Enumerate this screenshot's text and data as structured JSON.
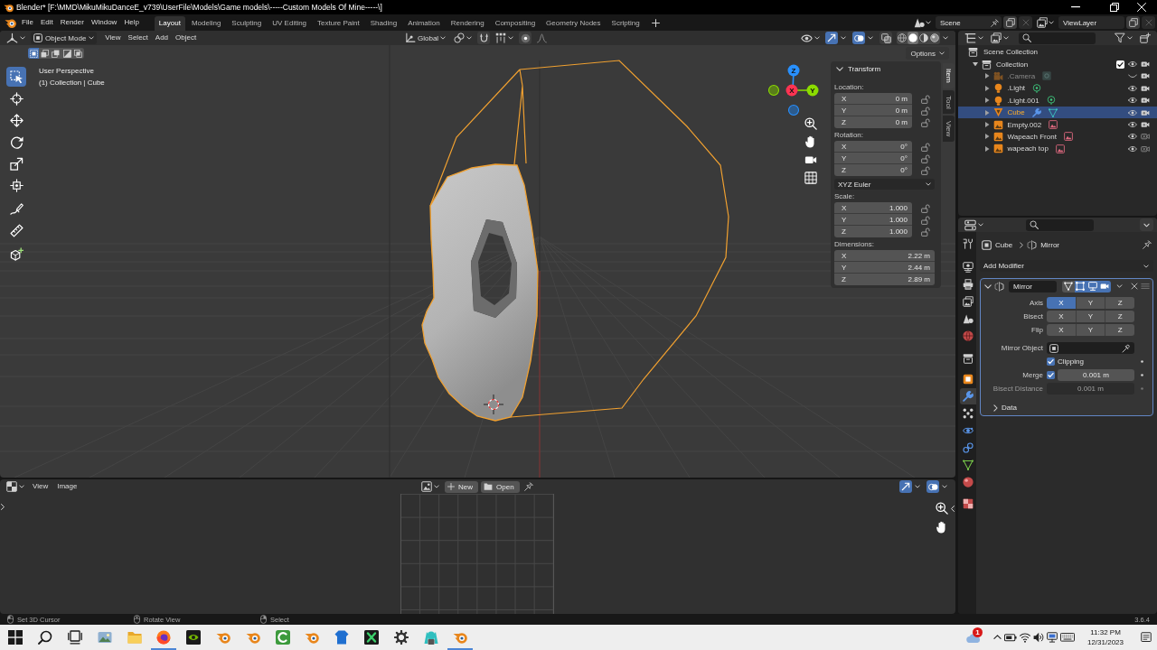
{
  "window": {
    "title": "Blender* [F:\\MMD\\MikuMikuDanceE_v739\\UserFile\\Models\\Game models\\-----Custom Models Of Mine-----\\]"
  },
  "menu": [
    "File",
    "Edit",
    "Render",
    "Window",
    "Help"
  ],
  "workspaces": [
    {
      "label": "Layout",
      "selected": true
    },
    {
      "label": "Modeling",
      "selected": false
    },
    {
      "label": "Sculpting",
      "selected": false
    },
    {
      "label": "UV Editing",
      "selected": false
    },
    {
      "label": "Texture Paint",
      "selected": false
    },
    {
      "label": "Shading",
      "selected": false
    },
    {
      "label": "Animation",
      "selected": false
    },
    {
      "label": "Rendering",
      "selected": false
    },
    {
      "label": "Compositing",
      "selected": false
    },
    {
      "label": "Geometry Nodes",
      "selected": false
    },
    {
      "label": "Scripting",
      "selected": false
    }
  ],
  "scene": "Scene",
  "view_layer": "ViewLayer",
  "viewport": {
    "header": {
      "mode": "Object Mode",
      "menus": [
        "View",
        "Select",
        "Add",
        "Object"
      ],
      "orientation": "Global",
      "snap": false,
      "proportional_edit": false,
      "show_gizmos": true,
      "show_overlays": true,
      "xray": false,
      "shading": [
        {
          "kind": "wireframe",
          "selected": false
        },
        {
          "kind": "solid",
          "selected": true
        },
        {
          "kind": "material",
          "selected": false
        },
        {
          "kind": "rendered",
          "selected": false
        }
      ]
    },
    "select_modes": [
      {
        "kind": "set",
        "selected": true
      },
      {
        "kind": "extend",
        "selected": false
      },
      {
        "kind": "subtract",
        "selected": false
      },
      {
        "kind": "invert",
        "selected": false
      },
      {
        "kind": "intersect",
        "selected": false
      }
    ],
    "options": "Options",
    "tools": [
      {
        "kind": "select",
        "selected": true
      },
      {
        "kind": "cursor",
        "selected": false
      },
      {
        "kind": "move",
        "selected": false
      },
      {
        "kind": "rotate",
        "selected": false
      },
      {
        "kind": "scale",
        "selected": false
      },
      {
        "kind": "transform",
        "selected": false
      },
      {
        "kind": "annotate",
        "selected": false
      },
      {
        "kind": "measure",
        "selected": false
      },
      {
        "kind": "addcube",
        "selected": false
      }
    ],
    "view_name": "User Perspective",
    "context": "(1) Collection | Cube",
    "gizmo_axes": [
      {
        "label": "X",
        "color": "#ff3352"
      },
      {
        "label": "Y",
        "color": "#8bdc00"
      },
      {
        "label": "Z",
        "color": "#2890ff"
      }
    ],
    "transform": {
      "title": "Transform",
      "rotation_mode": "XYZ Euler",
      "groups": [
        {
          "kind": "location",
          "label": "Location:",
          "fields": [
            {
              "axis": "X",
              "value": "0 m",
              "locked": false
            },
            {
              "axis": "Y",
              "value": "0 m",
              "locked": false
            },
            {
              "axis": "Z",
              "value": "0 m",
              "locked": false
            }
          ]
        },
        {
          "kind": "rotation",
          "label": "Rotation:",
          "fields": [
            {
              "axis": "X",
              "value": "0°",
              "locked": false
            },
            {
              "axis": "Y",
              "value": "0°",
              "locked": false
            },
            {
              "axis": "Z",
              "value": "0°",
              "locked": false
            }
          ]
        },
        {
          "kind": "scale",
          "label": "Scale:",
          "fields": [
            {
              "axis": "X",
              "value": "1.000",
              "locked": false
            },
            {
              "axis": "Y",
              "value": "1.000",
              "locked": false
            },
            {
              "axis": "Z",
              "value": "1.000",
              "locked": false
            }
          ]
        },
        {
          "kind": "dimensions",
          "label": "Dimensions:",
          "fields": [
            {
              "axis": "X",
              "value": "2.22 m"
            },
            {
              "axis": "Y",
              "value": "2.44 m"
            },
            {
              "axis": "Z",
              "value": "2.89 m"
            }
          ]
        }
      ]
    },
    "sidebar_tabs": [
      {
        "label": "Item",
        "selected": true
      },
      {
        "label": "Tool",
        "selected": false
      },
      {
        "label": "View",
        "selected": false
      }
    ]
  },
  "image_editor": {
    "menus": [
      "View",
      "Image"
    ],
    "new": "New",
    "open": "Open",
    "show_gizmos": true,
    "show_overlays": true
  },
  "outliner": {
    "root": "Scene Collection",
    "collections": [
      {
        "label": "Collection",
        "expanded": true,
        "checked": true,
        "visible": true,
        "renderable": true,
        "children": [
          {
            "label": ".Camera",
            "kind": "camera",
            "expanded": false,
            "selected": false,
            "visible": false,
            "renderable": true
          },
          {
            "label": ".Light",
            "kind": "light",
            "expanded": false,
            "selected": false,
            "visible": true,
            "renderable": true
          },
          {
            "label": ".Light.001",
            "kind": "light",
            "expanded": false,
            "selected": false,
            "visible": true,
            "renderable": true
          },
          {
            "label": "Cube",
            "kind": "mesh",
            "expanded": false,
            "selected": true,
            "visible": true,
            "renderable": true
          },
          {
            "label": "Empty.002",
            "kind": "image",
            "expanded": false,
            "selected": false,
            "visible": true,
            "renderable": true
          },
          {
            "label": "Wapeach Front",
            "kind": "image",
            "expanded": false,
            "selected": false,
            "visible": true,
            "renderable": false
          },
          {
            "label": "wapeach top",
            "kind": "image",
            "expanded": false,
            "selected": false,
            "visible": true,
            "renderable": false
          }
        ]
      }
    ]
  },
  "properties": {
    "tabs": [
      {
        "kind": "tool",
        "selected": false
      },
      {
        "kind": "render",
        "selected": false
      },
      {
        "kind": "output",
        "selected": false
      },
      {
        "kind": "viewlayer",
        "selected": false
      },
      {
        "kind": "scene",
        "selected": false
      },
      {
        "kind": "world",
        "selected": false
      },
      {
        "kind": "collection",
        "selected": false
      },
      {
        "kind": "object",
        "selected": false
      },
      {
        "kind": "modifiers",
        "selected": true
      },
      {
        "kind": "particles",
        "selected": false
      },
      {
        "kind": "physics",
        "selected": false
      },
      {
        "kind": "constraints",
        "selected": false
      },
      {
        "kind": "data",
        "selected": false
      },
      {
        "kind": "material",
        "selected": false
      },
      {
        "kind": "texture",
        "selected": false
      }
    ],
    "breadcrumb": [
      "Cube",
      "Mirror"
    ],
    "add_modifier": "Add Modifier",
    "modifier": {
      "name": "Mirror",
      "expanded": true,
      "toggles": [
        {
          "kind": "cage",
          "on": false
        },
        {
          "kind": "editmode",
          "on": true
        },
        {
          "kind": "viewport",
          "on": true
        },
        {
          "kind": "render",
          "on": true
        }
      ],
      "axis_rows": [
        {
          "label": "Axis",
          "options": [
            {
              "label": "X",
              "selected": true
            },
            {
              "label": "Y",
              "selected": false
            },
            {
              "label": "Z",
              "selected": false
            }
          ]
        },
        {
          "label": "Bisect",
          "options": [
            {
              "label": "X",
              "selected": false
            },
            {
              "label": "Y",
              "selected": false
            },
            {
              "label": "Z",
              "selected": false
            }
          ]
        },
        {
          "label": "Flip",
          "options": [
            {
              "label": "X",
              "selected": false
            },
            {
              "label": "Y",
              "selected": false
            },
            {
              "label": "Z",
              "selected": false
            }
          ]
        }
      ],
      "mirror_object": {
        "label": "Mirror Object"
      },
      "clipping": {
        "label": "Clipping",
        "checked": true
      },
      "merge": {
        "label": "Merge",
        "checked": true,
        "value": "0.001 m"
      },
      "bisect_distance": {
        "label": "Bisect Distance",
        "value": "0.001 m",
        "disabled": true
      },
      "subpanels": [
        {
          "label": "Data",
          "expanded": false
        }
      ]
    }
  },
  "status_bar": {
    "hints": [
      {
        "kind": "left",
        "label": "Set 3D Cursor"
      },
      {
        "kind": "middle",
        "label": "Rotate View"
      },
      {
        "kind": "right",
        "label": "Select"
      }
    ],
    "version": "3.6.4"
  },
  "taskbar": {
    "apps": [
      {
        "kind": "start",
        "running": false
      },
      {
        "kind": "search",
        "running": false
      },
      {
        "kind": "taskview",
        "running": false
      },
      {
        "kind": "photos",
        "running": false
      },
      {
        "kind": "folder",
        "running": false
      },
      {
        "kind": "browser",
        "running": true
      },
      {
        "kind": "chip",
        "running": false
      },
      {
        "kind": "blender",
        "running": false
      },
      {
        "kind": "blender",
        "running": false
      },
      {
        "kind": "letterc",
        "running": false
      },
      {
        "kind": "blender",
        "running": false
      },
      {
        "kind": "figure",
        "running": false
      },
      {
        "kind": "spreadsheet",
        "running": false
      },
      {
        "kind": "settings",
        "running": false
      },
      {
        "kind": "character",
        "running": false
      },
      {
        "kind": "blender",
        "running": true
      }
    ],
    "badge": "1",
    "time": "11:32 PM",
    "date": "12/31/2023"
  }
}
